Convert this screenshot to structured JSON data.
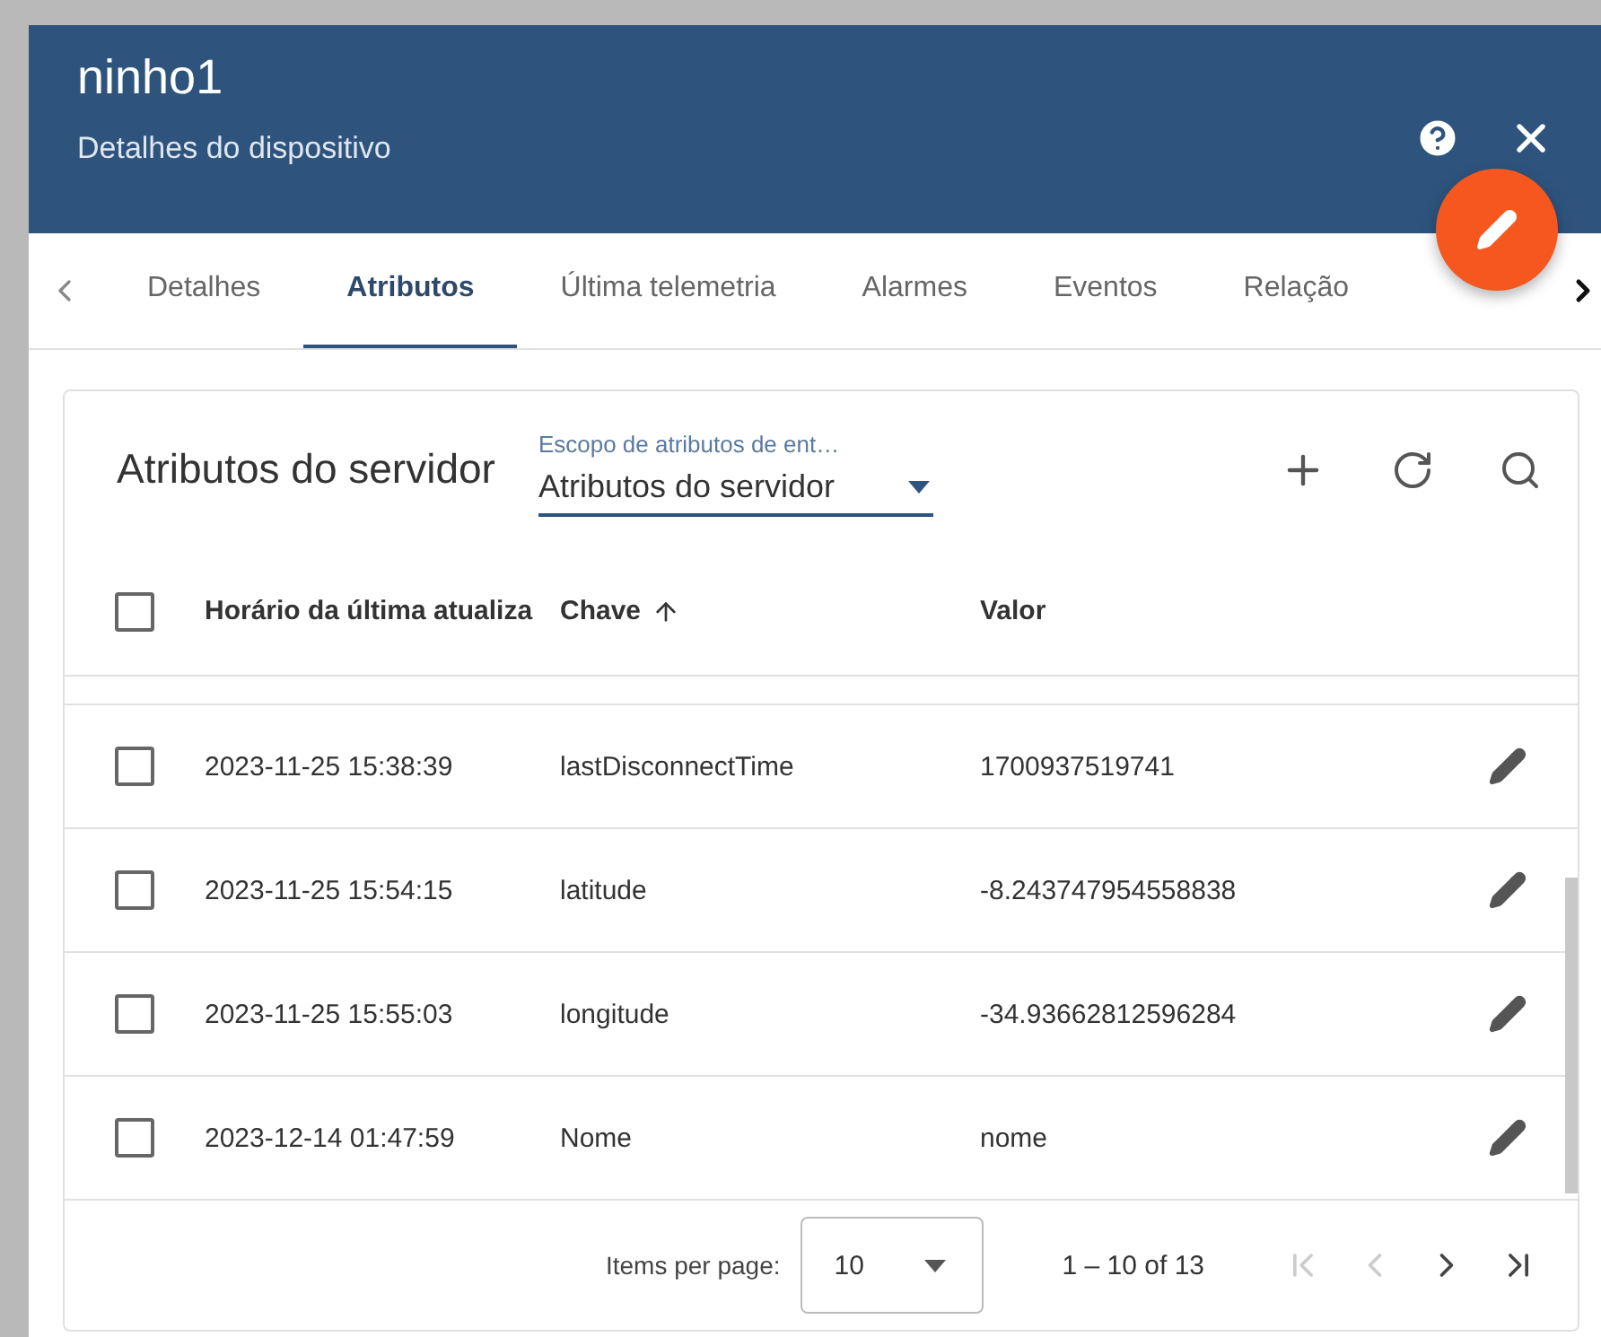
{
  "header": {
    "title": "ninho1",
    "subtitle": "Detalhes do dispositivo"
  },
  "tabs": [
    {
      "label": "Detalhes",
      "selected": false
    },
    {
      "label": "Atributos",
      "selected": true
    },
    {
      "label": "Última telemetria",
      "selected": false
    },
    {
      "label": "Alarmes",
      "selected": false
    },
    {
      "label": "Eventos",
      "selected": false
    },
    {
      "label": "Relação",
      "selected": false
    }
  ],
  "card": {
    "title": "Atributos do servidor",
    "scope": {
      "label": "Escopo de atributos de ent…",
      "value": "Atributos do servidor"
    }
  },
  "table": {
    "select_all": {
      "checked": false
    },
    "columns": [
      {
        "label": "Horário da última atualiza",
        "sorted": false
      },
      {
        "label": "Chave",
        "sorted": true
      },
      {
        "label": "Valor",
        "sorted": false
      }
    ],
    "rows": [
      {
        "checked": false,
        "cells": [
          "2023-11-25 15:38:39",
          "lastDisconnectTime",
          "1700937519741"
        ]
      },
      {
        "checked": false,
        "cells": [
          "2023-11-25 15:54:15",
          "latitude",
          "-8.243747954558838"
        ]
      },
      {
        "checked": false,
        "cells": [
          "2023-11-25 15:55:03",
          "longitude",
          "-34.93662812596284"
        ]
      },
      {
        "checked": false,
        "cells": [
          "2023-12-14 01:47:59",
          "Nome",
          "nome"
        ]
      }
    ]
  },
  "paginator": {
    "label": "Items per page:",
    "page_size": "10",
    "range": "1 – 10 of 13"
  }
}
